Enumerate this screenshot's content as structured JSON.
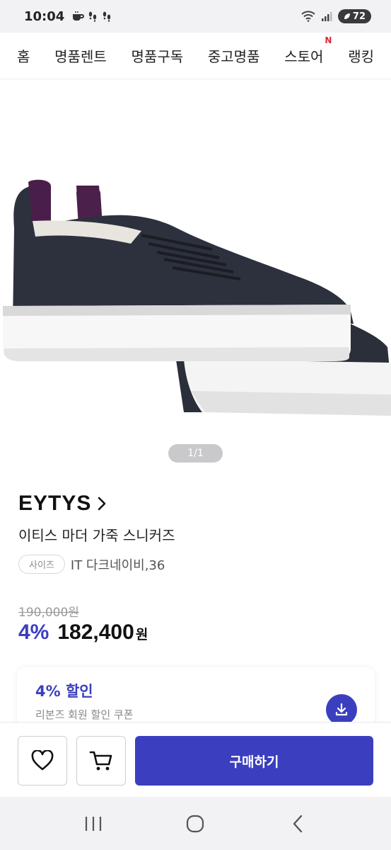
{
  "status_bar": {
    "time": "10:04",
    "battery": "72"
  },
  "nav": {
    "items": [
      {
        "label": "홈",
        "badge": ""
      },
      {
        "label": "명품렌트",
        "badge": ""
      },
      {
        "label": "명품구독",
        "badge": ""
      },
      {
        "label": "중고명품",
        "badge": ""
      },
      {
        "label": "스토어",
        "badge": "N"
      },
      {
        "label": "랭킹",
        "badge": ""
      }
    ]
  },
  "gallery": {
    "pager": "1/1",
    "icon": "sneaker-photo"
  },
  "product": {
    "brand": "EYTYS",
    "title": "이티스 마더 가죽 스니커즈",
    "option_label": "사이즈",
    "option_value": "IT 다크네이비,36",
    "original_price": "190,000원",
    "discount": "4%",
    "price": "182,400",
    "currency": "원"
  },
  "coupon": {
    "title": "4% 할인",
    "subtitle": "리본즈 회원 할인 쿠폰"
  },
  "actions": {
    "buy_label": "구매하기"
  },
  "colors": {
    "accent": "#3b3fbf",
    "badge": "#e0243a"
  }
}
